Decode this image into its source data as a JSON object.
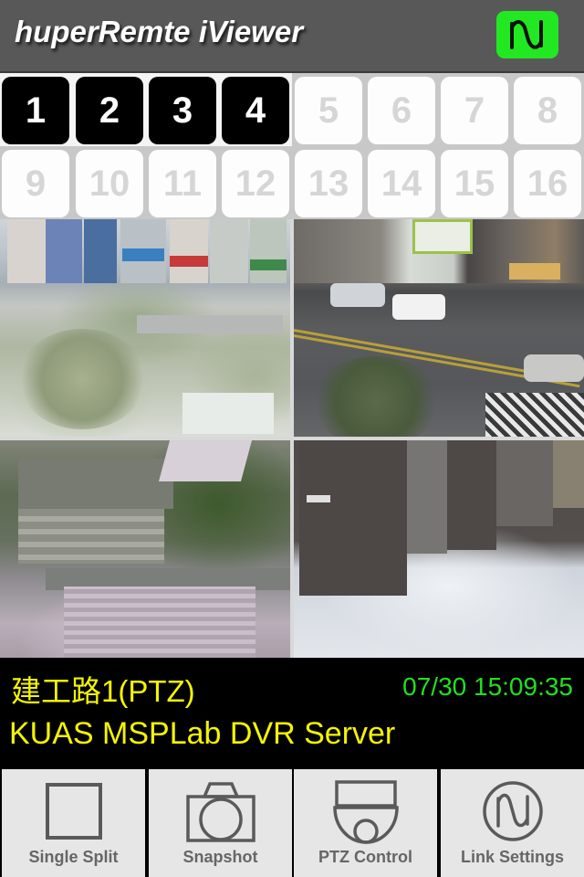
{
  "header": {
    "title": "huperRemte iViewer",
    "link_button_icon": "signal-wave-icon",
    "link_button_color": "#22e822"
  },
  "channels": {
    "items": [
      {
        "label": "1",
        "active": true
      },
      {
        "label": "2",
        "active": true
      },
      {
        "label": "3",
        "active": true
      },
      {
        "label": "4",
        "active": true
      },
      {
        "label": "5",
        "active": false
      },
      {
        "label": "6",
        "active": false
      },
      {
        "label": "7",
        "active": false
      },
      {
        "label": "8",
        "active": false
      },
      {
        "label": "9",
        "active": false
      },
      {
        "label": "10",
        "active": false
      },
      {
        "label": "11",
        "active": false
      },
      {
        "label": "12",
        "active": false
      },
      {
        "label": "13",
        "active": false
      },
      {
        "label": "14",
        "active": false
      },
      {
        "label": "15",
        "active": false
      },
      {
        "label": "16",
        "active": false
      }
    ]
  },
  "cameras": [
    {
      "channel": "1",
      "scene": "street with palm trees and storefronts"
    },
    {
      "channel": "2",
      "scene": "intersection with cars and scooters"
    },
    {
      "channel": "3",
      "scene": "aerial view of building and plaza"
    },
    {
      "channel": "4",
      "scene": "elevator lobby with tiled floor"
    }
  ],
  "info": {
    "camera_name": "建工路1(PTZ)",
    "timestamp": "07/30 15:09:35",
    "server_name": "KUAS MSPLab DVR Server",
    "camera_name_color": "#f4f400",
    "timestamp_color": "#20e020"
  },
  "toolbar": {
    "buttons": [
      {
        "label": "Single Split",
        "icon": "single-split-icon"
      },
      {
        "label": "Snapshot",
        "icon": "camera-icon"
      },
      {
        "label": "PTZ Control",
        "icon": "dome-camera-icon"
      },
      {
        "label": "Link Settings",
        "icon": "signal-wave-icon"
      }
    ]
  }
}
